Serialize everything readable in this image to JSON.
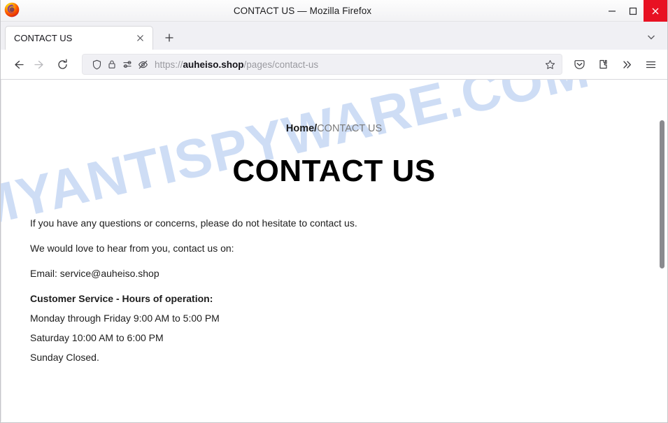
{
  "window": {
    "title": "CONTACT US — Mozilla Firefox",
    "minimize_label": "Minimize",
    "maximize_label": "Maximize",
    "close_label": "Close",
    "close_color": "#e81123"
  },
  "tabs": {
    "items": [
      {
        "label": "CONTACT US",
        "close_label": "×",
        "active": true
      }
    ],
    "new_tab_label": "+",
    "list_all_tabs_label": "List all tabs"
  },
  "toolbar": {
    "back_label": "Back",
    "forward_label": "Forward",
    "reload_label": "Reload",
    "bookmark_label": "Bookmark this page",
    "pocket_label": "Save to Pocket",
    "extensions_label": "Extensions",
    "overflow_label": "More tools",
    "menu_label": "Open application menu"
  },
  "address_bar": {
    "scheme": "https://",
    "host": "auheiso.shop",
    "path": "/pages/contact-us",
    "full_url": "https://auheiso.shop/pages/contact-us",
    "shield_label": "Tracking protection",
    "lock_label": "Connection secure",
    "permissions_label": "Site permissions",
    "autoplay_blocked_label": "Autoplay blocked"
  },
  "page": {
    "watermark": "MYANTISPYWARE.COM",
    "watermark_color": "#ccdcf5",
    "breadcrumb": {
      "home": "Home",
      "separator": "/",
      "current": "CONTACT US"
    },
    "heading": "CONTACT US",
    "paragraphs": [
      "If you have any questions or concerns, please do not hesitate to contact us.",
      "We would love to hear from you, contact us on:",
      "Email: service@auheiso.shop"
    ],
    "hours_heading": "Customer Service - Hours of operation:",
    "hours_lines": [
      "Monday through Friday 9:00 AM to 5:00 PM",
      "Saturday 10:00 AM to 6:00 PM",
      "Sunday Closed."
    ]
  }
}
